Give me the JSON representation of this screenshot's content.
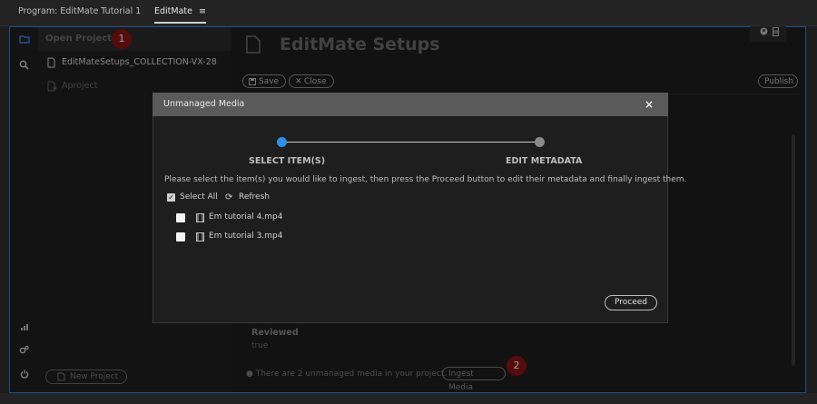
{
  "tabs": [
    {
      "label": "Program: EditMate Tutorial 1"
    },
    {
      "label": "EditMate"
    }
  ],
  "tab_menu_glyph": "≡",
  "sidebar_rail": {
    "icons": [
      "folder-icon",
      "search-icon",
      "signal-icon",
      "settings-icon",
      "power-icon"
    ]
  },
  "projects_panel": {
    "header": "Open Projects",
    "badge": "1",
    "items": [
      {
        "label": "EditMateSetups_COLLECTION-VX-28",
        "icon": "document-icon"
      },
      {
        "label": "Aproject",
        "icon": "document-open-icon"
      }
    ],
    "new_project_label": "New Project"
  },
  "main": {
    "title": "EditMate Setups",
    "save_label": "Save",
    "close_label": "Close",
    "publish_label": "Publish",
    "reviewed_label": "Reviewed",
    "reviewed_value": "true",
    "unmanaged_notice": "There are 2 unmanaged media in your project.",
    "ingest_label": "Ingest Media",
    "badge": "2"
  },
  "modal": {
    "title": "Unmanaged Media",
    "close_glyph": "×",
    "step1_label": "SELECT ITEM(S)",
    "step2_label": "EDIT METADATA",
    "instructions": "Please select the item(s) you would like to ingest, then press the Proceed button to edit their metadata and finally ingest them.",
    "select_all_label": "Select All",
    "refresh_label": "Refresh",
    "files": [
      {
        "name": "Em tutorial 4.mp4",
        "checked": false
      },
      {
        "name": "Em tutorial 3.mp4",
        "checked": false
      }
    ],
    "proceed_label": "Proceed"
  },
  "colors": {
    "frame_border": "#2f7fd6",
    "step_active": "#2f8fe6",
    "badge": "#8b1414"
  }
}
